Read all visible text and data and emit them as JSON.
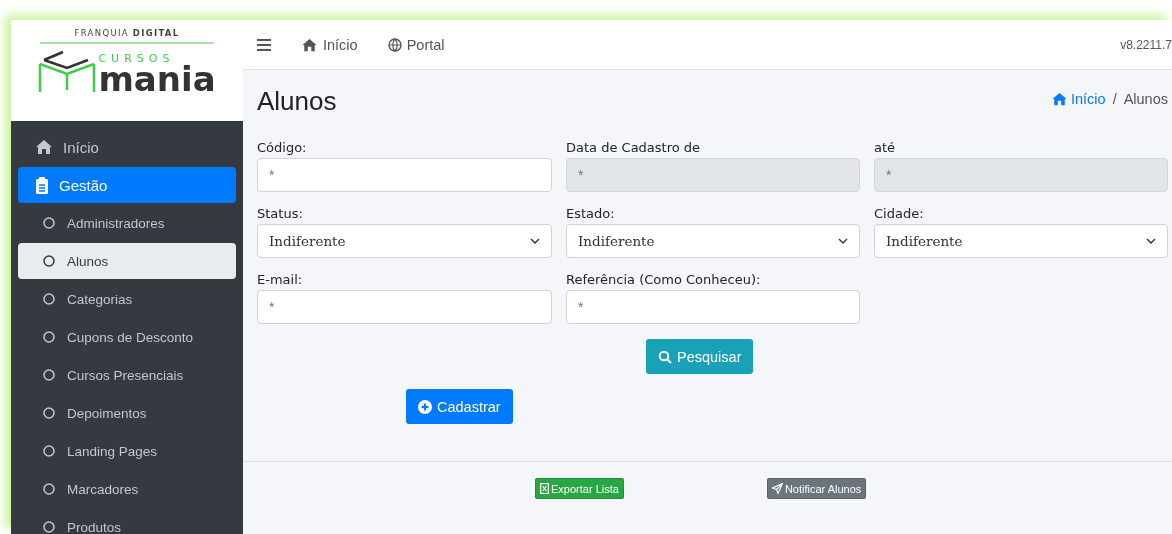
{
  "brand": {
    "tagline": "FRANQUIA **DIGITAL**",
    "word_top": "CURSOS",
    "word_main": "mania"
  },
  "sidebar": {
    "items": [
      {
        "kind": "link",
        "label": "Início",
        "selected": false
      },
      {
        "kind": "group",
        "label": "Gestão",
        "selected": true
      },
      {
        "kind": "sub",
        "label": "Administradores",
        "selected": false
      },
      {
        "kind": "sub",
        "label": "Alunos",
        "selected": true
      },
      {
        "kind": "sub",
        "label": "Categorias",
        "selected": false
      },
      {
        "kind": "sub",
        "label": "Cupons de Desconto",
        "selected": false
      },
      {
        "kind": "sub",
        "label": "Cursos Presenciais",
        "selected": false
      },
      {
        "kind": "sub",
        "label": "Depoimentos",
        "selected": false
      },
      {
        "kind": "sub",
        "label": "Landing Pages",
        "selected": false
      },
      {
        "kind": "sub",
        "label": "Marcadores",
        "selected": false
      },
      {
        "kind": "sub",
        "label": "Produtos",
        "selected": false
      }
    ]
  },
  "topbar": {
    "links": [
      "Início",
      "Portal"
    ],
    "version": "v8.2211.7"
  },
  "page": {
    "title": "Alunos",
    "breadcrumb": [
      "Início",
      "Alunos"
    ],
    "breadcrumb_separator": "/"
  },
  "fields": [
    {
      "kind": "text",
      "label": "Código:",
      "placeholder": "*",
      "disabled": false
    },
    {
      "kind": "text",
      "label": "Data de Cadastro de",
      "placeholder": "*",
      "disabled": true
    },
    {
      "kind": "text",
      "label": "até",
      "placeholder": "*",
      "disabled": true
    },
    {
      "kind": "select",
      "label": "Status:",
      "value": "Indiferente",
      "disabled": false
    },
    {
      "kind": "select",
      "label": "Estado:",
      "value": "Indiferente",
      "disabled": false
    },
    {
      "kind": "select",
      "label": "Cidade:",
      "value": "Indiferente",
      "disabled": false
    },
    {
      "kind": "text",
      "label": "E-mail:",
      "placeholder": "*",
      "disabled": false
    },
    {
      "kind": "text",
      "label": "Referência (Como Conheceu):",
      "placeholder": "*",
      "disabled": false
    }
  ],
  "buttons": {
    "search": "Pesquisar",
    "create": "Cadastrar",
    "export": "Exportar Lista",
    "notify": "Notificar Alunos"
  }
}
